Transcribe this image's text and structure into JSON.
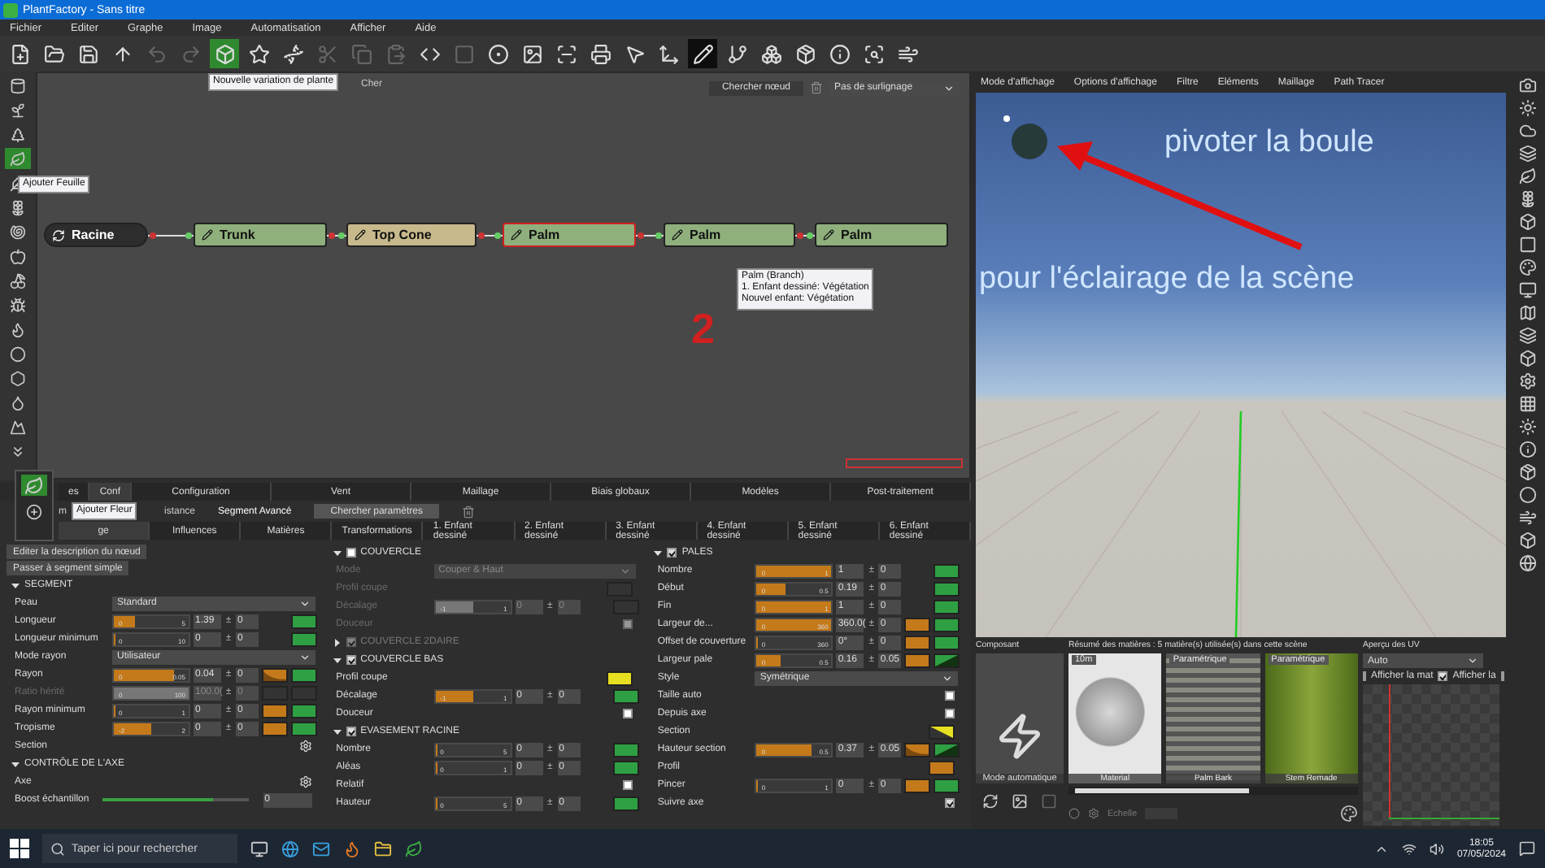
{
  "window": {
    "title": "PlantFactory - Sans titre"
  },
  "menu": [
    "Fichier",
    "Editer",
    "Graphe",
    "Image",
    "Automatisation",
    "Afficher",
    "Aide"
  ],
  "toolbar": {
    "tools": [
      {
        "kind": "normal"
      },
      {
        "kind": "normal"
      },
      {
        "kind": "normal"
      },
      {
        "kind": "normal"
      },
      {
        "kind": "disabled"
      },
      {
        "kind": "disabled"
      },
      {
        "kind": "selected"
      },
      {
        "kind": "normal"
      },
      {
        "kind": "normal"
      },
      {
        "kind": "disabled"
      },
      {
        "kind": "disabled"
      },
      {
        "kind": "disabled"
      },
      {
        "kind": "normal"
      },
      {
        "kind": "disabled"
      },
      {
        "kind": "normal"
      },
      {
        "kind": "normal"
      },
      {
        "kind": "normal"
      },
      {
        "kind": "normal"
      },
      {
        "kind": "normal"
      },
      {
        "kind": "normal"
      },
      {
        "kind": "pressed"
      },
      {
        "kind": "normal"
      },
      {
        "kind": "normal"
      },
      {
        "kind": "normal"
      },
      {
        "kind": "normal"
      },
      {
        "kind": "normal"
      },
      {
        "kind": "normal"
      }
    ],
    "tooltip": "Nouvelle variation de plante",
    "hidden_label": "Cher"
  },
  "left_tools": [
    {
      "selected": false
    },
    {
      "selected": false
    },
    {
      "selected": false
    },
    {
      "selected": true
    },
    {
      "selected": false
    },
    {
      "selected": false
    },
    {
      "selected": false
    },
    {
      "selected": false
    },
    {
      "selected": false
    },
    {
      "selected": false
    },
    {
      "selected": false
    },
    {
      "selected": false
    },
    {
      "selected": false
    },
    {
      "selected": false
    },
    {
      "selected": false
    },
    {
      "selected": false
    }
  ],
  "left_tooltip": "Ajouter Feuille",
  "node_graph": {
    "search_button": "Chercher nœud",
    "highlight": "Pas de surlignage",
    "nodes": [
      {
        "label": "Racine",
        "kind": "root",
        "selected": false
      },
      {
        "label": "Trunk",
        "kind": "green",
        "selected": false
      },
      {
        "label": "Top Cone",
        "kind": "tan",
        "selected": false
      },
      {
        "label": "Palm",
        "kind": "green",
        "selected": true
      },
      {
        "label": "Palm",
        "kind": "green",
        "selected": false
      },
      {
        "label": "Palm",
        "kind": "green",
        "selected": false
      }
    ],
    "node_tooltip": [
      "Palm (Branch)",
      "1. Enfant dessiné: Végétation",
      "Nouvel enfant: Végétation"
    ],
    "annotation": "2"
  },
  "flower_popup": {
    "tooltip": "Ajouter Fleur"
  },
  "bottom_panel": {
    "tabs": [
      {
        "label": "es",
        "selected": false
      },
      {
        "label": "Conf",
        "selected": true
      },
      {
        "label": "Configuration",
        "selected": false
      },
      {
        "label": "Vent",
        "selected": false
      },
      {
        "label": "Maillage",
        "selected": false
      },
      {
        "label": "Biais globaux",
        "selected": false
      },
      {
        "label": "Modèles",
        "selected": false
      },
      {
        "label": "Post-traitement",
        "selected": false
      }
    ],
    "subtabs": [
      {
        "label": "m",
        "selected": false
      },
      {
        "label": "istance",
        "selected": false
      },
      {
        "label": "Segment Avancé",
        "selected": true
      }
    ],
    "search_button": "Chercher paramètres",
    "child_tabs": [
      {
        "label": "ge",
        "selected": true
      },
      {
        "label": "Influences",
        "selected": false
      },
      {
        "label": "Matières",
        "selected": false
      },
      {
        "label": "Transformations",
        "selected": false
      },
      {
        "label": "1. Enfant dessiné",
        "selected": false
      },
      {
        "label": "2. Enfant dessiné",
        "selected": false
      },
      {
        "label": "3. Enfant dessiné",
        "selected": false
      },
      {
        "label": "4. Enfant dessiné",
        "selected": false
      },
      {
        "label": "5. Enfant dessiné",
        "selected": false
      },
      {
        "label": "6. Enfant dessiné",
        "selected": false
      }
    ],
    "columns": [
      {
        "buttons": [
          "Editer la description du nœud",
          "Passer à segment simple"
        ],
        "sections": [
          {
            "title": "SEGMENT",
            "kind": "plain",
            "rows": [
              {
                "kind": "dropdown",
                "label": "Peau",
                "value": "Standard",
                "disabled": false
              },
              {
                "kind": "slider",
                "label": "Longueur",
                "min": "0",
                "max": "5",
                "level": 0.28,
                "value": "1.39",
                "pm": "±",
                "spread": "0",
                "extras": [
                  {
                    "kind": "none"
                  },
                  {
                    "kind": "green"
                  }
                ],
                "disabled": false
              },
              {
                "kind": "slider",
                "label": "Longueur minimum",
                "min": "0",
                "max": "10",
                "level": 0,
                "value": "0",
                "pm": "±",
                "spread": "0",
                "extras": [
                  {
                    "kind": "none"
                  },
                  {
                    "kind": "green"
                  }
                ],
                "disabled": false
              },
              {
                "kind": "dropdown",
                "label": "Mode rayon",
                "value": "Utilisateur",
                "disabled": false
              },
              {
                "kind": "slider",
                "label": "Rayon",
                "min": "0",
                "max": "0.05",
                "level": 0.8,
                "value": "0.04",
                "pm": "±",
                "spread": "0",
                "extras": [
                  {
                    "kind": "curve"
                  },
                  {
                    "kind": "green"
                  }
                ],
                "disabled": false
              },
              {
                "kind": "slider",
                "label": "Ratio hérité",
                "min": "0",
                "max": "100",
                "level": 1,
                "value": "100.0(",
                "pm": "±",
                "spread": "0",
                "extras": [
                  {
                    "kind": "empty"
                  },
                  {
                    "kind": "empty"
                  }
                ],
                "disabled": true
              },
              {
                "kind": "slider",
                "label": "Rayon minimum",
                "min": "0",
                "max": "1",
                "level": 0,
                "value": "0",
                "pm": "±",
                "spread": "0",
                "extras": [
                  {
                    "kind": "orange"
                  },
                  {
                    "kind": "green"
                  }
                ],
                "disabled": false
              },
              {
                "kind": "slider",
                "label": "Tropisme",
                "min": "-2",
                "max": "2",
                "level": 0.5,
                "value": "0",
                "pm": "±",
                "spread": "0",
                "extras": [
                  {
                    "kind": "orange"
                  },
                  {
                    "kind": "green"
                  }
                ],
                "disabled": false
              },
              {
                "kind": "gear",
                "label": "Section",
                "disabled": false
              }
            ]
          },
          {
            "title": "CONTRÔLE DE L'AXE",
            "kind": "plain",
            "rows": [
              {
                "kind": "gear",
                "label": "Axe",
                "disabled": false
              },
              {
                "kind": "boost",
                "label": "Boost échantillon",
                "level": 0.75,
                "value": "0",
                "disabled": false
              }
            ]
          }
        ]
      },
      {
        "sections": [
          {
            "title": "COUVERCLE",
            "kind": "check",
            "checked": false,
            "expanded": true,
            "rows": [
              {
                "kind": "dropdown",
                "label": "Mode",
                "value": "Couper & Haut",
                "disabled": true
              },
              {
                "kind": "swatch",
                "label": "Profil coupe",
                "extras": [
                  {
                    "kind": "empty"
                  }
                ],
                "disabled": true
              },
              {
                "kind": "slider",
                "label": "Décalage",
                "min": "-1",
                "max": "1",
                "level": 0.5,
                "value": "0",
                "pm": "±",
                "spread": "0",
                "extras": [
                  {
                    "kind": "empty"
                  }
                ],
                "disabled": true
              },
              {
                "kind": "checkbox",
                "label": "Douceur",
                "checked": false,
                "disabled": true
              }
            ]
          },
          {
            "title": "COUVERCLE 2DAIRE",
            "kind": "check",
            "checked": true,
            "expanded": false
          },
          {
            "title": "COUVERCLE BAS",
            "kind": "check",
            "checked": true,
            "expanded": true,
            "rows": [
              {
                "kind": "swatch",
                "label": "Profil coupe",
                "extras": [
                  {
                    "kind": "yellow"
                  }
                ],
                "disabled": false
              },
              {
                "kind": "slider",
                "label": "Décalage",
                "min": "-1",
                "max": "1",
                "level": 0.5,
                "value": "0",
                "pm": "±",
                "spread": "0",
                "extras": [
                  {
                    "kind": "green"
                  }
                ],
                "disabled": false
              },
              {
                "kind": "checkbox",
                "label": "Douceur",
                "checked": false,
                "disabled": false
              }
            ]
          },
          {
            "title": "EVASEMENT RACINE",
            "kind": "check",
            "checked": true,
            "expanded": true,
            "rows": [
              {
                "kind": "slider",
                "label": "Nombre",
                "min": "0",
                "max": "5",
                "level": 0,
                "value": "0",
                "pm": "±",
                "spread": "0",
                "extras": [
                  {
                    "kind": "green"
                  }
                ],
                "disabled": false
              },
              {
                "kind": "slider",
                "label": "Aléas",
                "min": "0",
                "max": "1",
                "level": 0,
                "value": "0",
                "pm": "±",
                "spread": "0",
                "extras": [
                  {
                    "kind": "green"
                  }
                ],
                "disabled": false
              },
              {
                "kind": "checkbox",
                "label": "Relatif",
                "checked": false,
                "disabled": false
              },
              {
                "kind": "slider",
                "label": "Hauteur",
                "min": "0",
                "max": "5",
                "level": 0,
                "value": "0",
                "pm": "±",
                "spread": "0",
                "extras": [
                  {
                    "kind": "green"
                  }
                ],
                "disabled": false
              }
            ]
          }
        ]
      },
      {
        "sections": [
          {
            "title": "PALES",
            "kind": "check",
            "checked": true,
            "expanded": true,
            "rows": [
              {
                "kind": "slider",
                "label": "Nombre",
                "min": "0",
                "max": "1",
                "level": 1,
                "value": "1",
                "pm": "±",
                "spread": "0",
                "extras": [
                  {
                    "kind": "none"
                  },
                  {
                    "kind": "green"
                  }
                ],
                "disabled": false
              },
              {
                "kind": "slider",
                "label": "Début",
                "min": "0",
                "max": "0.5",
                "level": 0.38,
                "value": "0.19",
                "pm": "±",
                "spread": "0",
                "extras": [
                  {
                    "kind": "none"
                  },
                  {
                    "kind": "green"
                  }
                ],
                "disabled": false
              },
              {
                "kind": "slider",
                "label": "Fin",
                "min": "0",
                "max": "1",
                "level": 1,
                "value": "1",
                "pm": "±",
                "spread": "0",
                "extras": [
                  {
                    "kind": "none"
                  },
                  {
                    "kind": "green"
                  }
                ],
                "disabled": false
              },
              {
                "kind": "slider",
                "label": "Largeur de...",
                "min": "0",
                "max": "360",
                "level": 1,
                "value": "360.0(",
                "pm": "±",
                "spread": "0",
                "extras": [
                  {
                    "kind": "orange"
                  },
                  {
                    "kind": "green"
                  }
                ],
                "disabled": false
              },
              {
                "kind": "slider",
                "label": "Offset de couverture",
                "min": "0",
                "max": "360",
                "level": 0,
                "value": "0°",
                "pm": "±",
                "spread": "0",
                "extras": [
                  {
                    "kind": "orange"
                  },
                  {
                    "kind": "green"
                  }
                ],
                "disabled": false
              },
              {
                "kind": "slider",
                "label": "Largeur pale",
                "min": "0",
                "max": "0.5",
                "level": 0.32,
                "value": "0.16",
                "pm": "±",
                "spread": "0.05",
                "extras": [
                  {
                    "kind": "orange"
                  },
                  {
                    "kind": "ramp"
                  }
                ],
                "disabled": false
              },
              {
                "kind": "dropdown",
                "label": "Style",
                "value": "Symétrique",
                "disabled": false
              },
              {
                "kind": "checkbox",
                "label": "Taille auto",
                "checked": false,
                "disabled": false
              },
              {
                "kind": "checkbox",
                "label": "Depuis axe",
                "checked": false,
                "disabled": false
              },
              {
                "kind": "swatch",
                "label": "Section",
                "extras": [
                  {
                    "kind": "yellowramp"
                  }
                ],
                "disabled": false
              },
              {
                "kind": "slider",
                "label": "Hauteur section",
                "min": "0",
                "max": "0.5",
                "level": 0.74,
                "value": "0.37",
                "pm": "±",
                "spread": "0.05",
                "extras": [
                  {
                    "kind": "curve"
                  },
                  {
                    "kind": "ramp"
                  }
                ],
                "disabled": false
              },
              {
                "kind": "swatch",
                "label": "Profil",
                "extras": [
                  {
                    "kind": "orange"
                  }
                ],
                "disabled": false
              },
              {
                "kind": "slider",
                "label": "Pincer",
                "min": "0",
                "max": "1",
                "level": 0,
                "value": "0",
                "pm": "±",
                "spread": "0",
                "extras": [
                  {
                    "kind": "orange"
                  },
                  {
                    "kind": "green"
                  }
                ],
                "disabled": false
              },
              {
                "kind": "checkbox",
                "label": "Suivre axe",
                "checked": true,
                "disabled": false
              }
            ]
          }
        ]
      }
    ]
  },
  "viewport": {
    "tabs": [
      "Mode d'affichage",
      "Options d'affichage",
      "Filtre",
      "Eléments",
      "Maillage",
      "Path Tracer"
    ],
    "notes": [
      "pivoter la boule",
      "pour l'éclairage de la scène"
    ]
  },
  "component_panel": {
    "title": "Composant",
    "mode": "Mode automatique"
  },
  "materials_panel": {
    "title": "Résumé des matières : 5 matière(s) utilisée(s) dans cette scène",
    "materials": [
      {
        "name": "Material",
        "badge": "10m",
        "kind": "sphere"
      },
      {
        "name": "Palm Bark",
        "badge": "Paramétrique",
        "kind": "bark"
      },
      {
        "name": "Stem Remade",
        "badge": "Paramétrique",
        "kind": "stem"
      }
    ],
    "scale_label": "Echelle"
  },
  "uv_panel": {
    "title": "Aperçu des UV",
    "mode": "Auto",
    "options": [
      {
        "label": "Afficher la mat",
        "checked": false
      },
      {
        "label": "Afficher la",
        "checked": true
      },
      {
        "checked": false
      }
    ]
  },
  "taskbar": {
    "search": "Taper ici pour rechercher",
    "time": "18:05",
    "date": "07/05/2024"
  }
}
